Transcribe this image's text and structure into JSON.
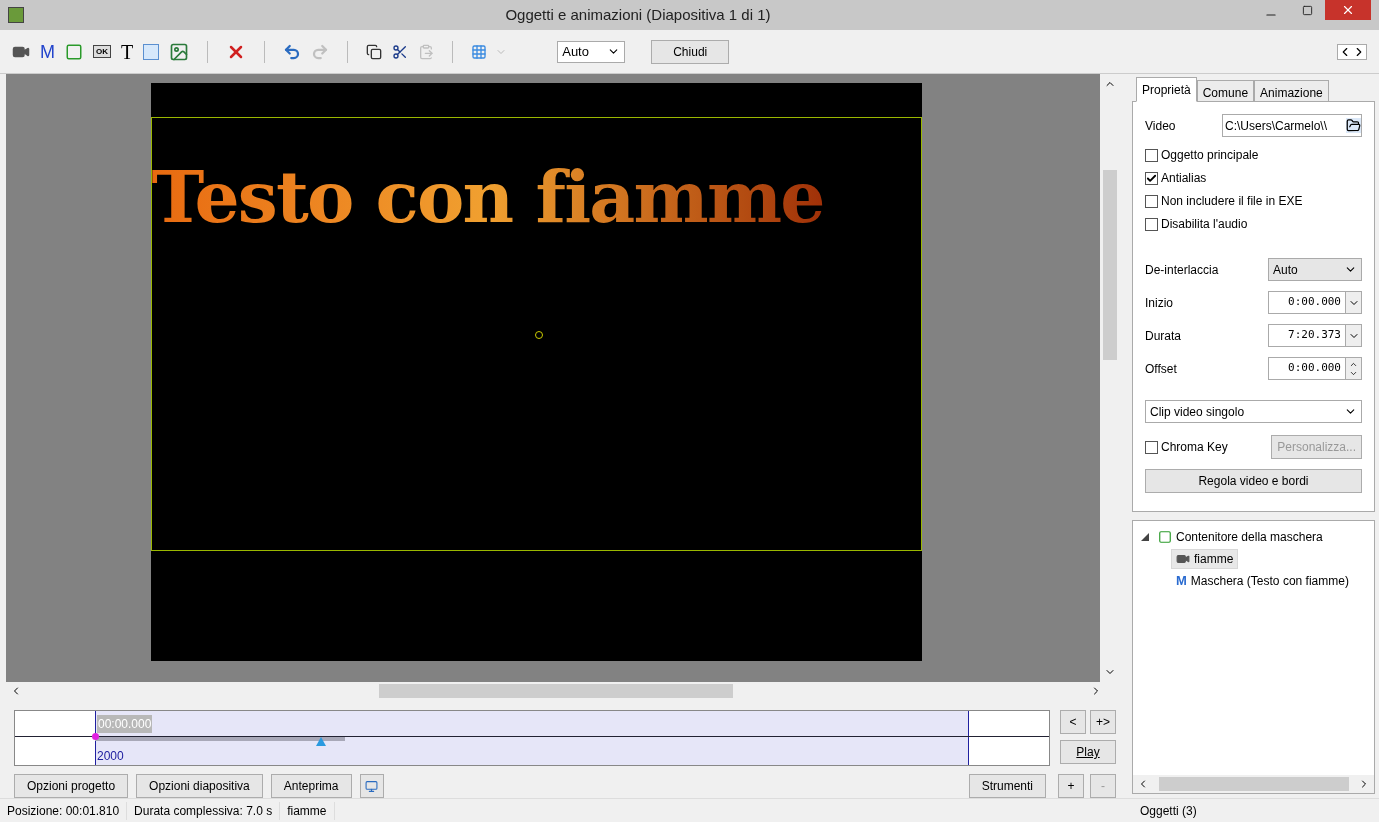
{
  "window": {
    "title": "Oggetti e animazioni  (Diapositiva 1 di 1)"
  },
  "toolbar": {
    "items": [
      {
        "kind": "camera"
      },
      {
        "kind": "glyph",
        "text": "M"
      },
      {
        "kind": "frame"
      },
      {
        "kind": "glyph",
        "text": "OK"
      },
      {
        "kind": "glyph",
        "text": "T"
      },
      {
        "kind": "rect"
      },
      {
        "kind": "image"
      },
      {
        "kind": "sep"
      },
      {
        "kind": "delete"
      },
      {
        "kind": "sep"
      },
      {
        "kind": "undo",
        "disabled": false
      },
      {
        "kind": "redo",
        "disabled": true
      },
      {
        "kind": "sep"
      },
      {
        "kind": "copy",
        "disabled": false
      },
      {
        "kind": "cut",
        "disabled": false
      },
      {
        "kind": "paste",
        "disabled": true
      },
      {
        "kind": "sep"
      },
      {
        "kind": "grid"
      }
    ],
    "zoom_select": {
      "value": "Auto"
    },
    "close_button": "Chiudi"
  },
  "canvas": {
    "slide_text": "Testo con fiamme"
  },
  "timeline": {
    "time": "00:00.000",
    "marker": "2000"
  },
  "timeline_buttons": [
    "<",
    "+>",
    "Play"
  ],
  "bottom_buttons": [
    "Opzioni progetto",
    "Opzioni diapositiva",
    "Anteprima"
  ],
  "tools_button": "Strumenti",
  "plus_minus": [
    {
      "label": "+",
      "disabled": false
    },
    {
      "label": "-",
      "disabled": true
    }
  ],
  "status_bar": [
    "Posizione:  00:01.810",
    "Durata complessiva:  7.0 s",
    "fiamme"
  ],
  "properties": {
    "tabs": [
      {
        "label": "Proprietà",
        "selected": true
      },
      {
        "label": "Comune",
        "selected": false
      },
      {
        "label": "Animazione",
        "selected": false
      }
    ],
    "video_label": "Video",
    "video_path": "C:\\Users\\Carmelo\\\\",
    "checkboxes": [
      {
        "label": "Oggetto principale",
        "checked": false
      },
      {
        "label": "Antialias",
        "checked": true
      },
      {
        "label": "Non includere il file in EXE",
        "checked": false
      },
      {
        "label": "Disabilita l'audio",
        "checked": false
      }
    ],
    "fields": [
      {
        "kind": "select",
        "label": "De-interlaccia",
        "value": "Auto"
      },
      {
        "kind": "time",
        "label": "Inizio",
        "value": "0:00.000"
      },
      {
        "kind": "time",
        "label": "Durata",
        "value": "7:20.373"
      },
      {
        "kind": "spin",
        "label": "Offset",
        "value": "0:00.000"
      }
    ],
    "clip_mode": "Clip video singolo",
    "chroma_key": {
      "label": "Chroma Key",
      "checked": false
    },
    "customize_button": {
      "label": "Personalizza...",
      "disabled": true
    },
    "adjust_button": "Regola video e bordi"
  },
  "object_tree": [
    {
      "kind": "container",
      "label": "Contenitore della maschera",
      "expanded": true,
      "selected": false,
      "children": [
        {
          "kind": "video",
          "label": "fiamme",
          "selected": true
        },
        {
          "kind": "mask",
          "glyph": "M",
          "label": "Maschera (Testo con fiamme)",
          "selected": false
        }
      ]
    }
  ],
  "objects_status": "Oggetti (3)"
}
